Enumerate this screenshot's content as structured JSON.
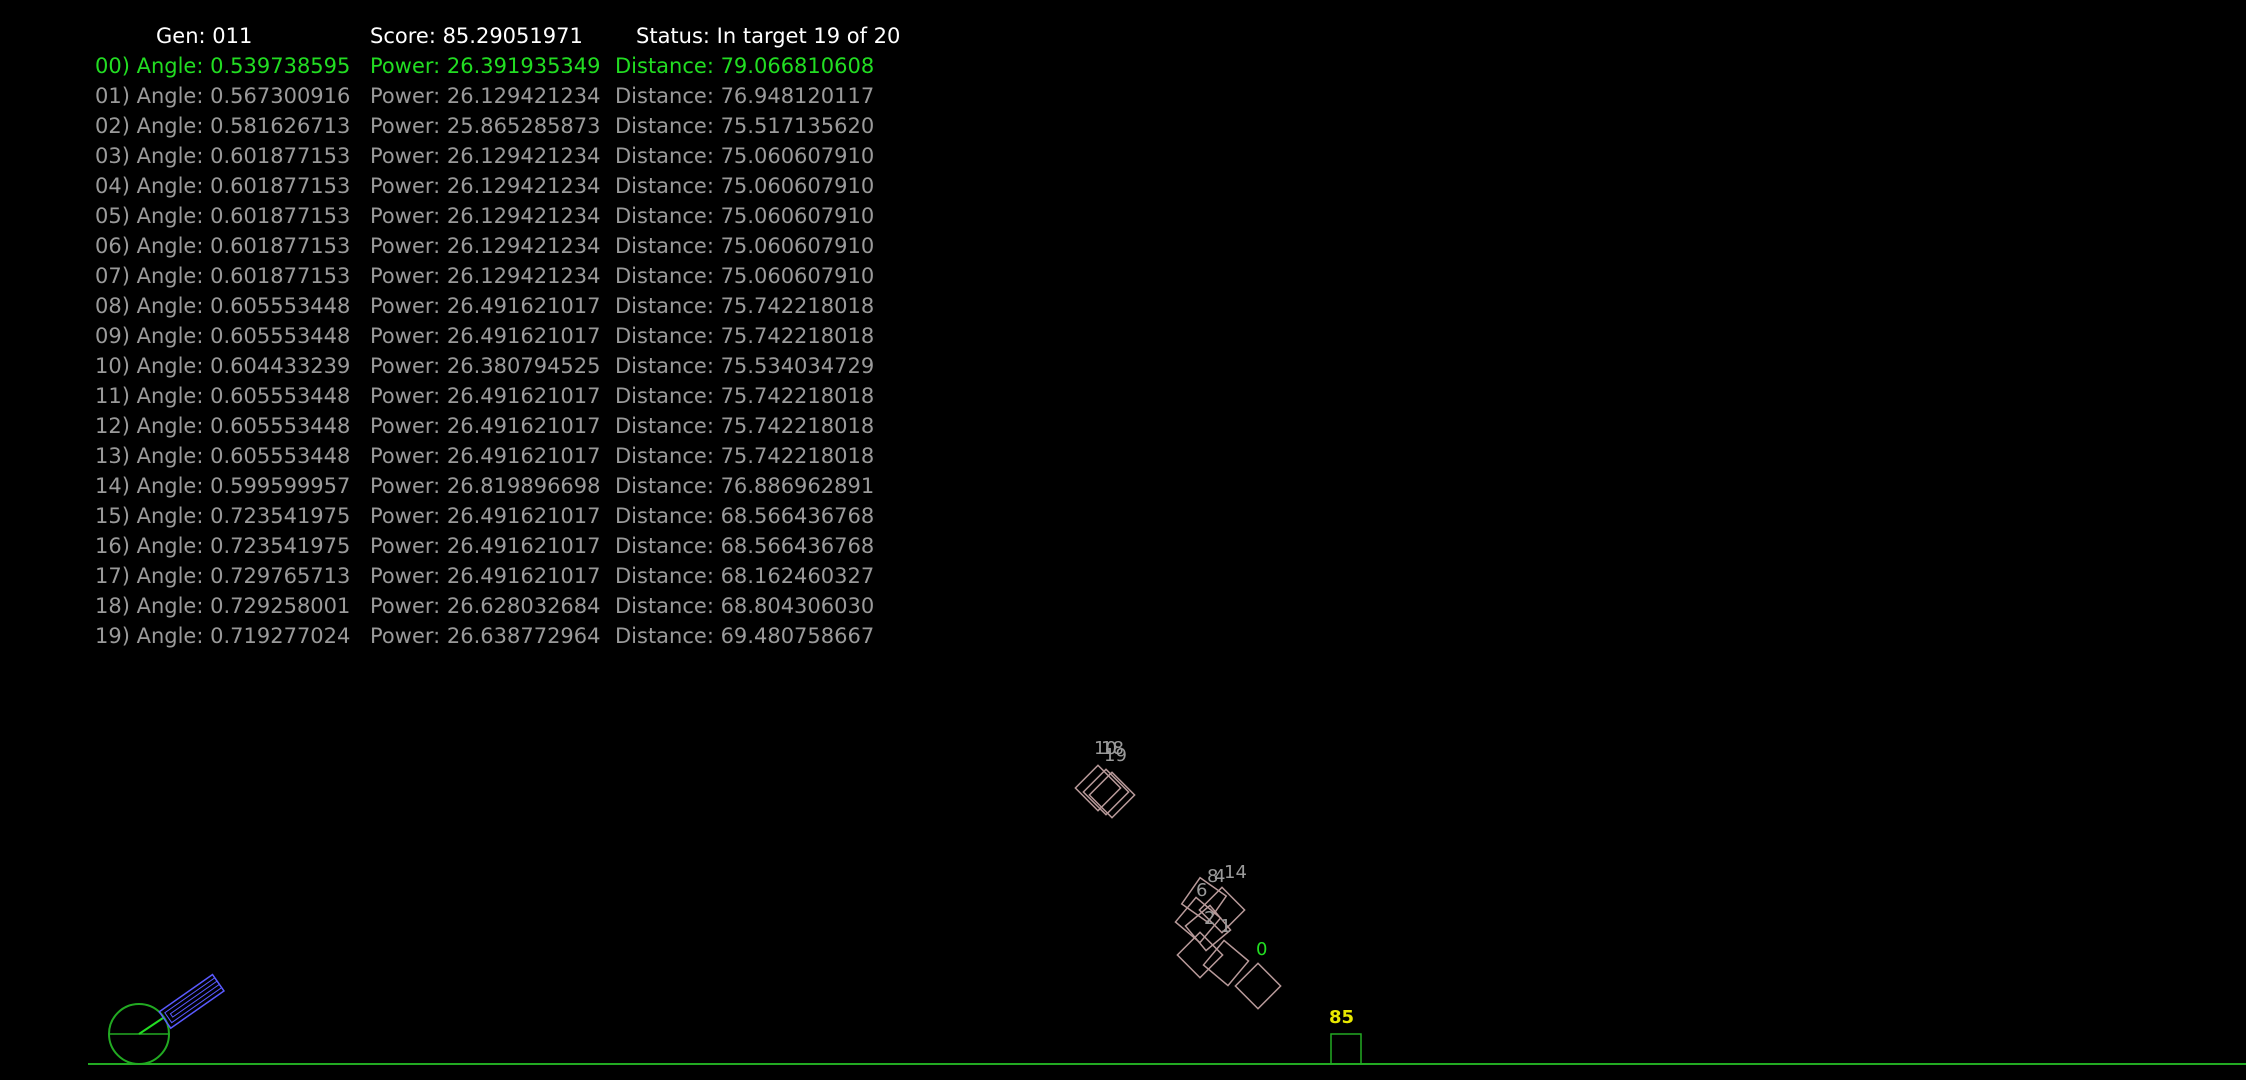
{
  "header": {
    "gen": "Gen: 011",
    "score": "Score: 85.29051971",
    "status": "Status: In target 19 of 20"
  },
  "rows": [
    {
      "angle": "00) Angle: 0.539738595",
      "power": "Power: 26.391935349",
      "distance": "Distance: 79.066810608",
      "best": true
    },
    {
      "angle": "01) Angle: 0.567300916",
      "power": "Power: 26.129421234",
      "distance": "Distance: 76.948120117"
    },
    {
      "angle": "02) Angle: 0.581626713",
      "power": "Power: 25.865285873",
      "distance": "Distance: 75.517135620"
    },
    {
      "angle": "03) Angle: 0.601877153",
      "power": "Power: 26.129421234",
      "distance": "Distance: 75.060607910"
    },
    {
      "angle": "04) Angle: 0.601877153",
      "power": "Power: 26.129421234",
      "distance": "Distance: 75.060607910"
    },
    {
      "angle": "05) Angle: 0.601877153",
      "power": "Power: 26.129421234",
      "distance": "Distance: 75.060607910"
    },
    {
      "angle": "06) Angle: 0.601877153",
      "power": "Power: 26.129421234",
      "distance": "Distance: 75.060607910"
    },
    {
      "angle": "07) Angle: 0.601877153",
      "power": "Power: 26.129421234",
      "distance": "Distance: 75.060607910"
    },
    {
      "angle": "08) Angle: 0.605553448",
      "power": "Power: 26.491621017",
      "distance": "Distance: 75.742218018"
    },
    {
      "angle": "09) Angle: 0.605553448",
      "power": "Power: 26.491621017",
      "distance": "Distance: 75.742218018"
    },
    {
      "angle": "10) Angle: 0.604433239",
      "power": "Power: 26.380794525",
      "distance": "Distance: 75.534034729"
    },
    {
      "angle": "11) Angle: 0.605553448",
      "power": "Power: 26.491621017",
      "distance": "Distance: 75.742218018"
    },
    {
      "angle": "12) Angle: 0.605553448",
      "power": "Power: 26.491621017",
      "distance": "Distance: 75.742218018"
    },
    {
      "angle": "13) Angle: 0.605553448",
      "power": "Power: 26.491621017",
      "distance": "Distance: 75.742218018"
    },
    {
      "angle": "14) Angle: 0.599599957",
      "power": "Power: 26.819896698",
      "distance": "Distance: 76.886962891"
    },
    {
      "angle": "15) Angle: 0.723541975",
      "power": "Power: 26.491621017",
      "distance": "Distance: 68.566436768"
    },
    {
      "angle": "16) Angle: 0.723541975",
      "power": "Power: 26.491621017",
      "distance": "Distance: 68.566436768"
    },
    {
      "angle": "17) Angle: 0.729765713",
      "power": "Power: 26.491621017",
      "distance": "Distance: 68.162460327"
    },
    {
      "angle": "18) Angle: 0.729258001",
      "power": "Power: 26.628032684",
      "distance": "Distance: 68.804306030"
    },
    {
      "angle": "19) Angle: 0.719277024",
      "power": "Power: 26.638772964",
      "distance": "Distance: 69.480758667"
    }
  ],
  "target": {
    "label": "85"
  },
  "projectile_labels": {
    "upper": [
      "10",
      "18",
      "19"
    ],
    "middle": [
      "8",
      "4",
      "14",
      "6",
      "2",
      "1"
    ],
    "best": "0"
  },
  "colors": {
    "best_row": "#22dd22",
    "row": "#9a9a9a",
    "header": "#ffffff",
    "ground": "#22aa22",
    "target_label": "#e8e800",
    "target_box": "#22aa22",
    "cannon_base": "#22aa22",
    "cannon_barrel": "#5a5aff",
    "box_outline": "#b89a9a",
    "best_label": "#22dd22"
  }
}
